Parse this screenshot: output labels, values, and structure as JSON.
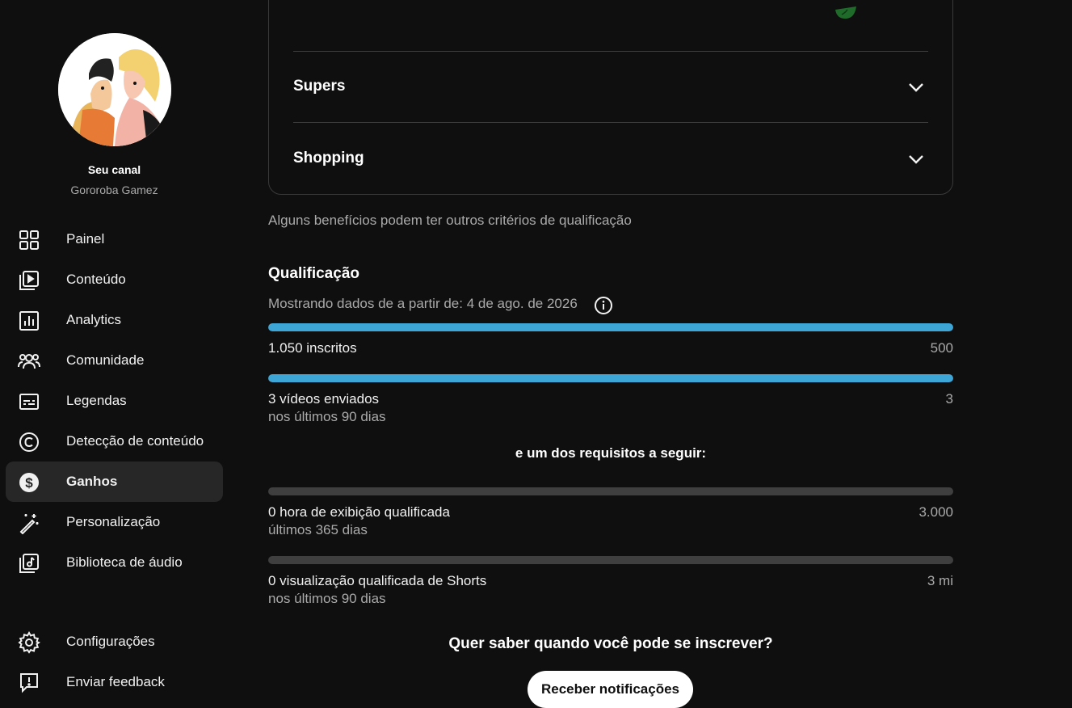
{
  "sidebar": {
    "channel_title": "Seu canal",
    "channel_name": "Gororoba Gamez",
    "items": [
      {
        "label": "Painel",
        "icon": "dashboard-icon"
      },
      {
        "label": "Conteúdo",
        "icon": "content-icon"
      },
      {
        "label": "Analytics",
        "icon": "analytics-icon"
      },
      {
        "label": "Comunidade",
        "icon": "community-icon"
      },
      {
        "label": "Legendas",
        "icon": "subtitles-icon"
      },
      {
        "label": "Detecção de conteúdo",
        "icon": "copyright-icon"
      },
      {
        "label": "Ganhos",
        "icon": "earn-icon",
        "active": true
      },
      {
        "label": "Personalização",
        "icon": "magic-wand-icon"
      },
      {
        "label": "Biblioteca de áudio",
        "icon": "audio-library-icon"
      }
    ],
    "bottom_items": [
      {
        "label": "Configurações",
        "icon": "gear-icon"
      },
      {
        "label": "Enviar feedback",
        "icon": "feedback-icon"
      }
    ]
  },
  "benefits": {
    "rows": [
      {
        "label": "Supers"
      },
      {
        "label": "Shopping"
      }
    ],
    "note": "Alguns benefícios podem ter outros critérios de qualificação"
  },
  "eligibility": {
    "title": "Qualificação",
    "showing": "Mostrando dados de a partir de: 4 de ago. de 2026",
    "requirements": [
      {
        "label": "1.050 inscritos",
        "sub": "",
        "target": "500",
        "progress": 1.0
      },
      {
        "label": "3 vídeos enviados",
        "sub": "nos últimos 90 dias",
        "target": "3",
        "progress": 1.0
      }
    ],
    "or_text": "e um dos requisitos a seguir:",
    "optional_requirements": [
      {
        "label": "0 hora de exibição qualificada",
        "sub": "últimos 365 dias",
        "target": "3.000",
        "progress": 0
      },
      {
        "label": "0 visualização qualificada de Shorts",
        "sub": "nos últimos 90 dias",
        "target": "3 mi",
        "progress": 0
      }
    ]
  },
  "cta": {
    "question": "Quer saber quando você pode se inscrever?",
    "button": "Receber notificações"
  },
  "colors": {
    "progress_fill": "#3ea6d6",
    "progress_track": "#3f3f3f",
    "background": "#0f0f0f",
    "active_nav": "#272727"
  }
}
